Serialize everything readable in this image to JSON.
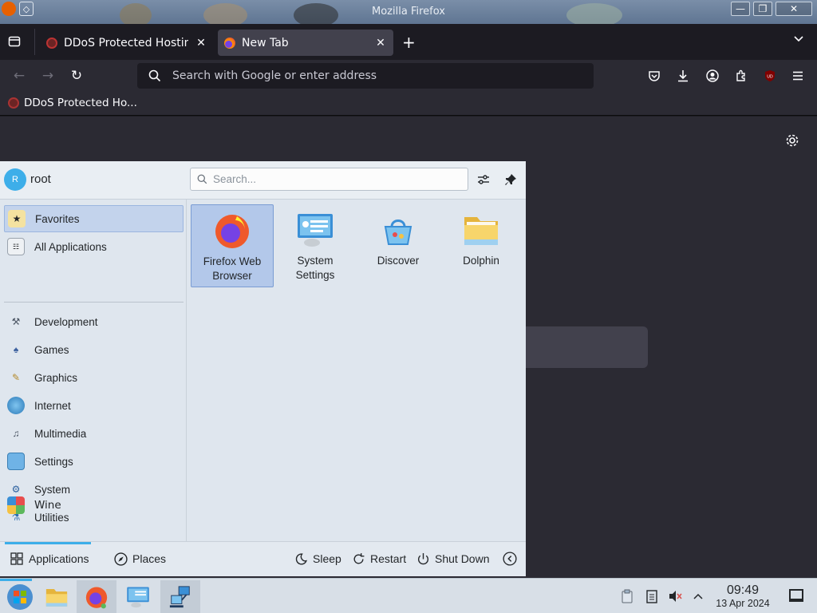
{
  "window": {
    "title": "Mozilla Firefox",
    "controls": {
      "minimize": "—",
      "maximize": "❐",
      "close": "✕"
    }
  },
  "tabs": [
    {
      "title": "DDoS Protected Hosting",
      "active": false,
      "close": "✕"
    },
    {
      "title": "New Tab",
      "active": true,
      "close": "✕"
    }
  ],
  "tabbar": {
    "new_tab": "+",
    "list_all": "⌄"
  },
  "navbar": {
    "back": "←",
    "forward": "→",
    "reload": "↻",
    "url_placeholder": "Search with Google or enter address"
  },
  "bookmarks": [
    {
      "label": "DDoS Protected Ho..."
    }
  ],
  "launcher": {
    "user": {
      "initial": "R",
      "name": "root"
    },
    "search_placeholder": "Search...",
    "categories_top": [
      {
        "label": "Favorites",
        "icon": "favorites-icon",
        "selected": true
      },
      {
        "label": "All Applications",
        "icon": "all-applications-icon",
        "selected": false
      }
    ],
    "categories": [
      {
        "label": "Development",
        "icon": "development-icon"
      },
      {
        "label": "Games",
        "icon": "games-icon"
      },
      {
        "label": "Graphics",
        "icon": "graphics-icon"
      },
      {
        "label": "Internet",
        "icon": "internet-icon"
      },
      {
        "label": "Multimedia",
        "icon": "multimedia-icon"
      },
      {
        "label": "Settings",
        "icon": "settings-icon"
      },
      {
        "label": "System",
        "icon": "system-icon"
      },
      {
        "label": "Utilities",
        "icon": "utilities-icon"
      },
      {
        "label": "Wine",
        "icon": "wine-icon"
      }
    ],
    "favorites": [
      {
        "line1": "Firefox Web",
        "line2": "Browser",
        "icon": "firefox-icon",
        "selected": true
      },
      {
        "line1": "System",
        "line2": "Settings",
        "icon": "system-settings-icon",
        "selected": false
      },
      {
        "line1": "Discover",
        "line2": "",
        "icon": "discover-icon",
        "selected": false
      },
      {
        "line1": "Dolphin",
        "line2": "",
        "icon": "dolphin-icon",
        "selected": false
      }
    ],
    "footer": {
      "applications": "Applications",
      "places": "Places",
      "sleep": "Sleep",
      "restart": "Restart",
      "shutdown": "Shut Down"
    }
  },
  "taskbar": {
    "apps": [
      {
        "name": "start-menu",
        "active": false
      },
      {
        "name": "dolphin",
        "active": false
      },
      {
        "name": "firefox",
        "active": true
      },
      {
        "name": "system-settings",
        "active": false
      },
      {
        "name": "network",
        "active": true
      }
    ],
    "clock": {
      "time": "09:49",
      "date": "13 Apr 2024"
    }
  },
  "colors": {
    "accent": "#3daee9",
    "firefox_dark": "#1c1b22",
    "toolbar": "#2b2a33",
    "active_tab": "#42414d",
    "launcher_bg": "#dfe6ee",
    "selection": "#c3d3ec"
  }
}
